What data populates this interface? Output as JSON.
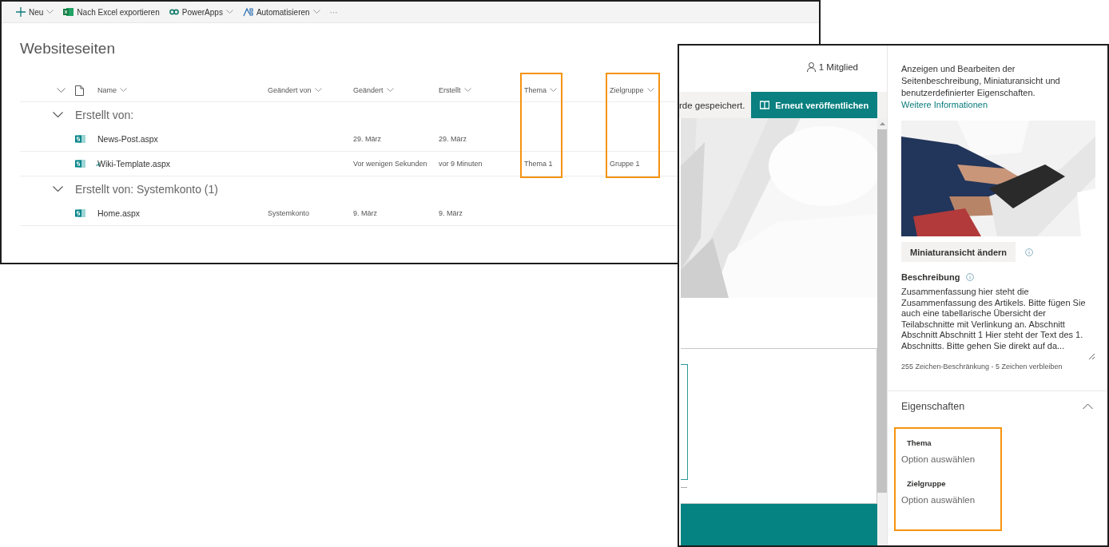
{
  "list_window": {
    "toolbar": [
      {
        "kind": "new",
        "label": "Neu",
        "menu": true
      },
      {
        "kind": "excel",
        "label": "Nach Excel exportieren",
        "menu": false
      },
      {
        "kind": "powerapps",
        "label": "PowerApps",
        "menu": true
      },
      {
        "kind": "flow",
        "label": "Automatisieren",
        "menu": true
      },
      {
        "kind": "more",
        "label": "···",
        "menu": false
      }
    ],
    "title": "Websiteseiten",
    "columns": [
      {
        "label": "Name",
        "highlighted": false
      },
      {
        "label": "Geändert von",
        "highlighted": false
      },
      {
        "label": "Geändert",
        "highlighted": false
      },
      {
        "label": "Erstellt",
        "highlighted": false
      },
      {
        "label": "Thema",
        "highlighted": true
      },
      {
        "label": "Zielgruppe",
        "highlighted": true
      }
    ],
    "groups": [
      {
        "label": "Erstellt von:",
        "expanded": true,
        "rows": [
          {
            "name": "News-Post.aspx",
            "checked_out": false,
            "modified": "29. März",
            "created": "29. März"
          },
          {
            "name": "Wiki-Template.aspx",
            "checked_out": true,
            "modified": "Vor wenigen Sekunden",
            "created": "vor 9 Minuten",
            "thema": "Thema 1",
            "zielgruppe": "Gruppe 1"
          }
        ]
      },
      {
        "label": "Erstellt von: Systemkonto (1)",
        "expanded": true,
        "rows": [
          {
            "name": "Home.aspx",
            "checked_out": false,
            "modified_by": "Systemkonto",
            "modified": "9. März",
            "created": "9. März"
          }
        ]
      }
    ]
  },
  "page_window": {
    "member_count": "1 Mitglied",
    "save_status": "rde gespeichert.",
    "republish_button": "Erneut veröffentlichen",
    "details_panel": {
      "intro": "Anzeigen und Bearbeiten der Seitenbeschreibung, Miniaturansicht und benutzerdefinierter Eigenschaften.",
      "intro_link": "Weitere Informationen",
      "change_thumbnail_button": "Miniaturansicht ändern",
      "description_label": "Beschreibung",
      "description": "Zusammenfassung hier steht die Zusammenfassung des Artikels. Bitte fügen Sie auch eine tabellarische Übersicht der Teilabschnitte mit Verlinkung an. Abschnitt Abschnitt Abschnitt 1 Hier steht der Text des 1. Abschnitts. Bitte gehen Sie direkt auf da...",
      "char_limit": "255 Zeichen-Beschränkung - 5 Zeichen verbleiben",
      "properties": {
        "title": "Eigenschaften",
        "expanded": true,
        "highlighted": true,
        "fields": [
          {
            "label": "Thema",
            "placeholder": "Option auswählen"
          },
          {
            "label": "Zielgruppe",
            "placeholder": "Option auswählen"
          }
        ]
      }
    }
  }
}
